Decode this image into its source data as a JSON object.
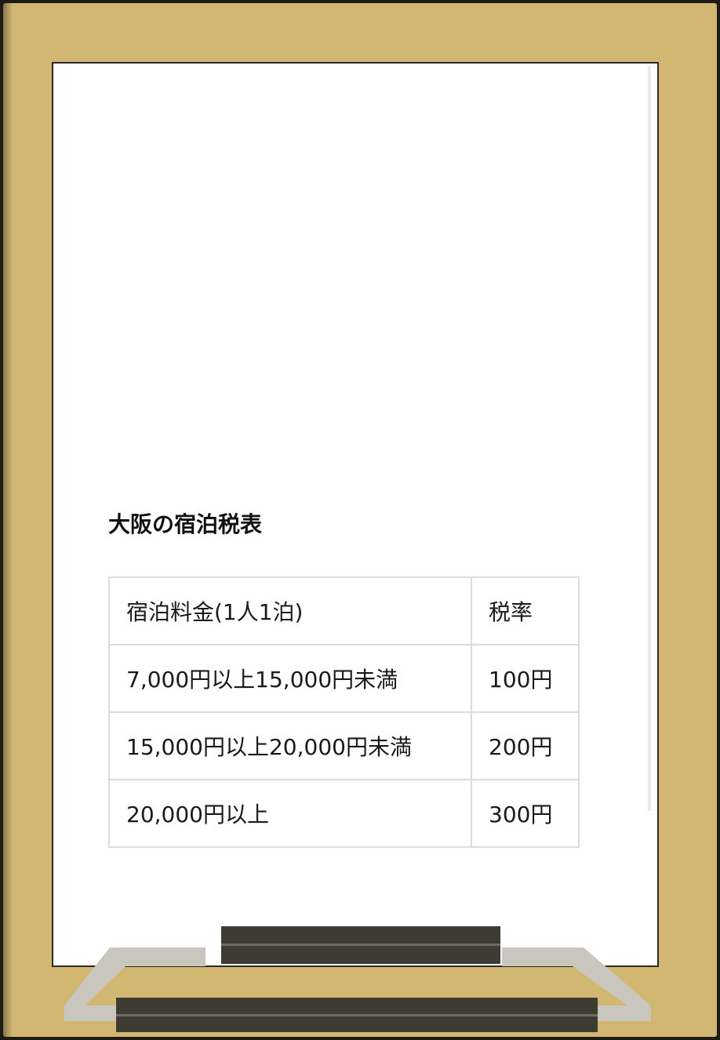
{
  "sign": {
    "heading": "大阪の宿泊税表",
    "table": {
      "header": {
        "fee": "宿泊料金(1人1泊)",
        "rate": "税率"
      },
      "rows": [
        {
          "fee": "7,000円以上15,000円未満",
          "rate": "100円"
        },
        {
          "fee": "15,000円以上20,000円未満",
          "rate": "200円"
        },
        {
          "fee": "20,000円以上",
          "rate": "300円"
        }
      ]
    }
  },
  "colors": {
    "frame": "#d2b772",
    "board": "#ffffff",
    "table_border": "#dcdcdc",
    "stand_dark": "#3e3b33",
    "stand_light": "#c9c6bd"
  }
}
